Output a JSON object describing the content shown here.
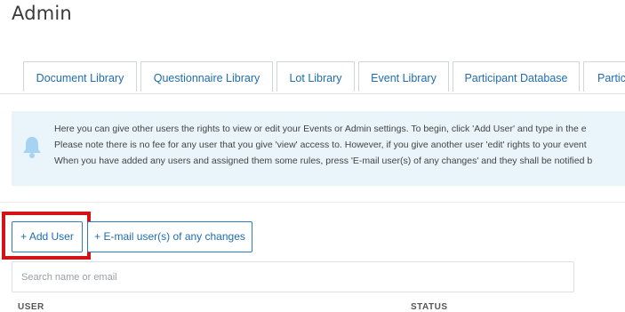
{
  "page": {
    "title": "Admin"
  },
  "tabs": [
    {
      "label": "Document Library"
    },
    {
      "label": "Questionnaire Library"
    },
    {
      "label": "Lot Library"
    },
    {
      "label": "Event Library"
    },
    {
      "label": "Participant Database"
    },
    {
      "label": "Partic"
    }
  ],
  "info": {
    "icon": "bell-icon",
    "lines": [
      "Here you can give other users the rights to view or edit your Events or Admin settings. To begin, click 'Add User' and type in the e",
      "Please note there is no fee for any user that you give 'view' access to. However, if you give another user 'edit' rights to your event",
      "When you have added any users and assigned them some rules, press 'E-mail user(s) of any changes' and they shall be notified b"
    ]
  },
  "actions": {
    "add_user_label": "+ Add User",
    "email_users_label": "+ E-mail user(s) of any changes"
  },
  "search": {
    "placeholder": "Search name or email",
    "value": ""
  },
  "table": {
    "columns": [
      "USER",
      "STATUS"
    ]
  },
  "colors": {
    "accent": "#1f6db0",
    "info_bg": "#eaf4fb",
    "highlight": "#d21419"
  }
}
